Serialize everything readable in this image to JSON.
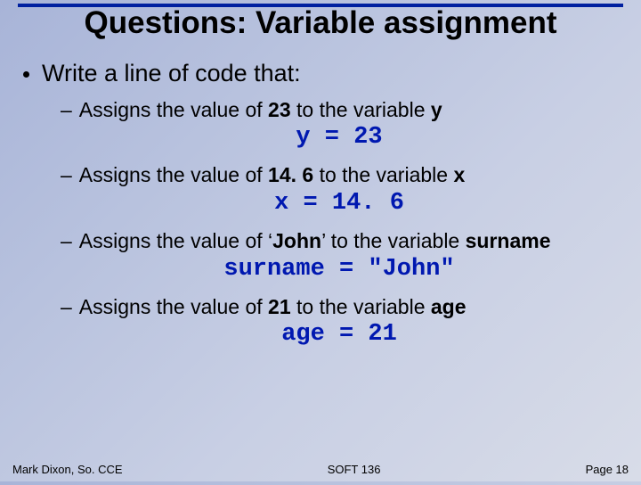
{
  "title": "Questions: Variable assignment",
  "intro": "Write a line of code that:",
  "items": [
    {
      "pre": "Assigns the value of ",
      "val": "23",
      "mid": " to the variable ",
      "var": "y",
      "code": "y = 23"
    },
    {
      "pre": "Assigns the value of ",
      "val": "14. 6",
      "mid": " to the variable ",
      "var": "x",
      "code": "x = 14. 6"
    },
    {
      "pre": "Assigns the value of ‘",
      "val": "John",
      "mid": "’ to the variable ",
      "var": "surname",
      "code": "surname = \"John\""
    },
    {
      "pre": "Assigns the value of ",
      "val": "21",
      "mid": " to the variable ",
      "var": "age",
      "code": "age = 21"
    }
  ],
  "footer": {
    "left": "Mark Dixon, So. CCE",
    "center": "SOFT 136",
    "right": "Page 18"
  }
}
